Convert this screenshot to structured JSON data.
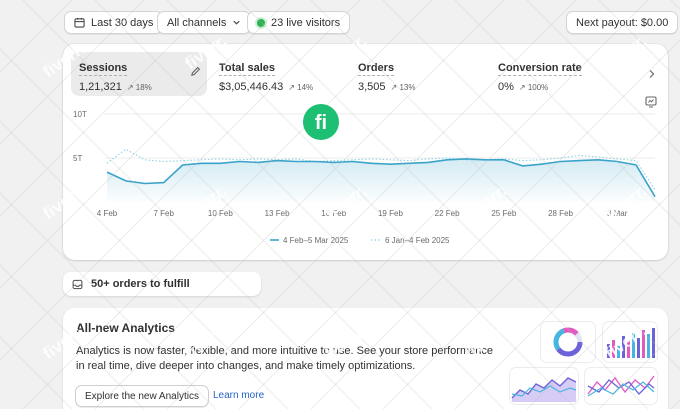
{
  "topbar": {
    "date_range": "Last 30 days",
    "channels": "All channels",
    "live_visitors": "23 live visitors",
    "next_payout": "Next payout: $0.00"
  },
  "metrics": [
    {
      "name": "Sessions",
      "value": "1,21,321",
      "change": "↗ 18%"
    },
    {
      "name": "Total sales",
      "value": "$3,05,446.43",
      "change": "↗ 14%"
    },
    {
      "name": "Orders",
      "value": "3,505",
      "change": "↗ 13%"
    },
    {
      "name": "Conversion rate",
      "value": "0%",
      "change": "↗ 100%"
    }
  ],
  "chart_data": {
    "type": "line",
    "x": [
      "4 Feb",
      "5 Feb",
      "6 Feb",
      "7 Feb",
      "8 Feb",
      "9 Feb",
      "10 Feb",
      "11 Feb",
      "12 Feb",
      "13 Feb",
      "14 Feb",
      "15 Feb",
      "16 Feb",
      "17 Feb",
      "18 Feb",
      "19 Feb",
      "20 Feb",
      "21 Feb",
      "22 Feb",
      "23 Feb",
      "24 Feb",
      "25 Feb",
      "26 Feb",
      "27 Feb",
      "28 Feb",
      "1 Mar",
      "2 Mar",
      "3 Mar",
      "4 Mar",
      "5 Mar"
    ],
    "tick_labels": [
      "4 Feb",
      "7 Feb",
      "10 Feb",
      "13 Feb",
      "16 Feb",
      "19 Feb",
      "22 Feb",
      "25 Feb",
      "28 Feb",
      "3 Mar"
    ],
    "yticks": [
      "10T",
      "5T"
    ],
    "ylim": [
      0,
      10
    ],
    "series": [
      {
        "name": "4 Feb–5 Mar 2025",
        "style": "solid",
        "color": "#3aa3c9",
        "values": [
          3.4,
          2.4,
          2.1,
          2.2,
          4.2,
          4.4,
          4.4,
          4.6,
          4.5,
          4.7,
          4.6,
          4.6,
          4.5,
          4.6,
          4.4,
          4.3,
          4.4,
          4.5,
          4.8,
          4.9,
          4.8,
          4.8,
          4.1,
          4.3,
          4.6,
          4.7,
          4.8,
          4.6,
          4.2,
          0.6
        ]
      },
      {
        "name": "6 Jan–4 Feb 2025",
        "style": "dotted",
        "color": "#8fd0e6",
        "values": [
          4.4,
          6.0,
          4.8,
          4.6,
          4.7,
          4.8,
          4.9,
          4.8,
          4.9,
          4.8,
          4.9,
          4.6,
          4.7,
          4.8,
          4.9,
          4.8,
          4.7,
          4.9,
          5.0,
          4.8,
          4.8,
          4.9,
          4.7,
          4.8,
          5.0,
          5.3,
          5.1,
          4.9,
          4.7,
          1.4
        ]
      }
    ],
    "grid": true,
    "legend": "bottom-center"
  },
  "orders_card": {
    "label": "50+ orders to fulfill"
  },
  "analytics": {
    "title": "All-new Analytics",
    "body": "Analytics is now faster, flexible, and more intuitive to use. See your store performance in real time, dive deeper into changes, and make timely optimizations.",
    "button": "Explore the new Analytics",
    "link": "Learn more"
  },
  "colors": {
    "accent": "#3aa3c9",
    "live": "#29b24f",
    "link": "#2563c9",
    "badge": "#1dbf73"
  },
  "watermark": {
    "brand": "fiverr.",
    "badge": "fi"
  }
}
